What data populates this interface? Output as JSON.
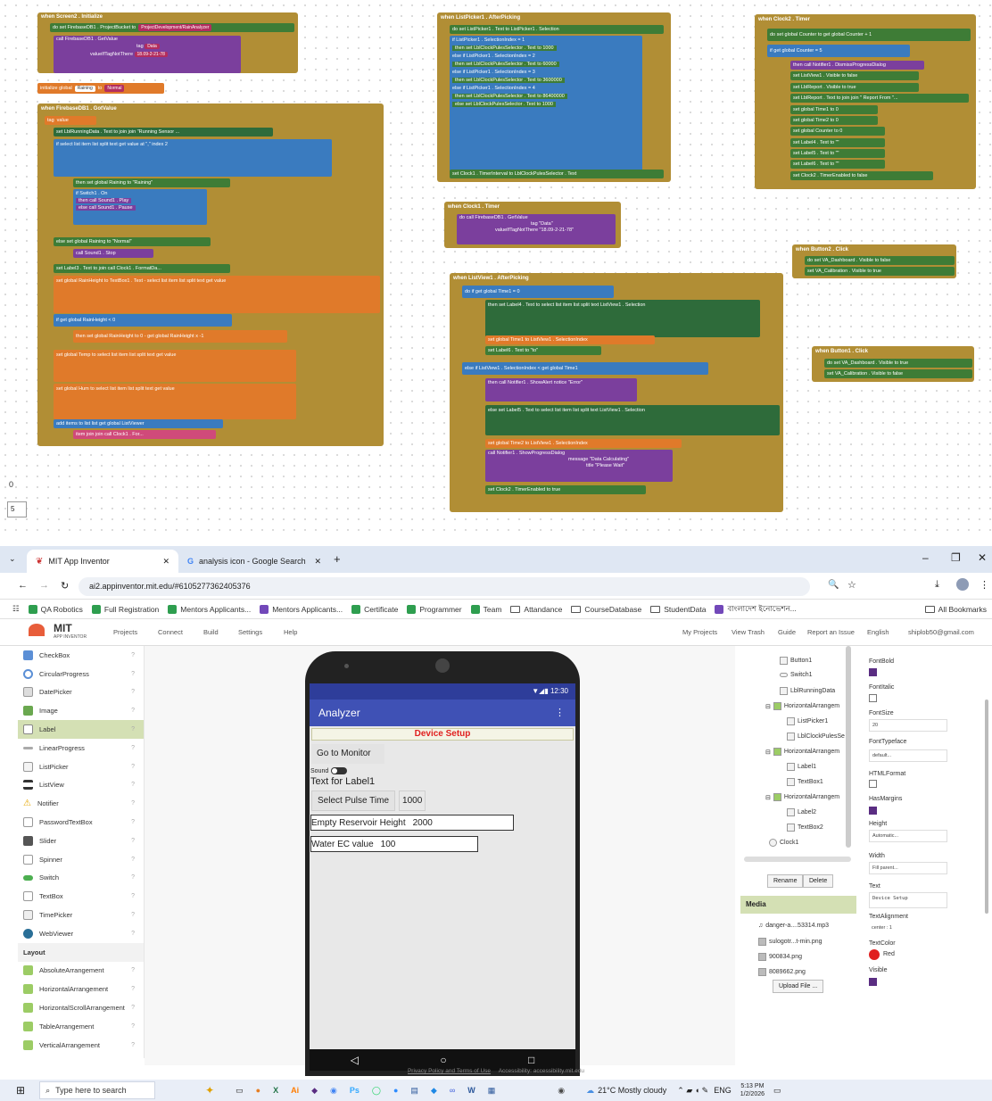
{
  "blocks": {
    "screen2_init": {
      "event": "when Screen2 . Initialize",
      "rows": [
        "do  set FirebaseDB1 . ProjectBucket to",
        "call FirebaseDB1 . GetValue",
        "tag",
        "valueIfTagNotThere"
      ],
      "bucket": "ProjectDevelopment/RainAnalyzer",
      "tag": "Data",
      "value": "18.09-2-21-78"
    },
    "init_global": {
      "label": "initialize global",
      "name": "Raining",
      "to": "to",
      "value": "Normal"
    },
    "firebase_got": {
      "event": "when FirebaseDB1 . GotValue",
      "params": [
        "tag",
        "value"
      ],
      "lines": [
        "set LblRunningData . Text to  join join \"Running Sensor ...",
        "if  select list item list  split text  get value  at  \",\"  index 2",
        "then  set global Raining to \"Raining\"",
        "if Switch1 . On",
        "then call Sound1 . Play",
        "else call Sound1 . Pause",
        "else set global Raining to \"Normal\"",
        "call Sound1 . Stop",
        "set Label3 . Text to  join call Clock1 . FormatDa...",
        "set global RainHeight to  TextBox1 . Text  -  select list item list  split text  get value",
        "index 1",
        "if  get global RainHeight  <  0",
        "then  set global RainHeight to  0  -  get global RainHeight  x  -1",
        "set global Temp to  select list item list  split text  get value",
        "index 3",
        "set global Hum to  select list item list  split text  get value",
        "index 4",
        "add items to list  list  get global ListViewer",
        "item  join join call Clock1 . For..."
      ]
    },
    "listpicker1": {
      "event": "when ListPicker1 . AfterPicking",
      "lines": [
        "do set ListPicker1 . Text to  ListPicker1 . Selection",
        "if  ListPicker1 . SelectionIndex  =  1",
        "then set LblClockPulesSelector . Text to 1000",
        "else if ListPicker1 . SelectionIndex = 2",
        "then set LblClockPulesSelector . Text to 60000",
        "else if ListPicker1 . SelectionIndex = 3",
        "then set LblClockPulesSelector . Text to 3600000",
        "else if ListPicker1 . SelectionIndex = 4",
        "then set LblClockPulesSelector . Text to 86400000",
        "else set LblClockPulesSelector . Text to 1000",
        "set Clock1 . TimerInterval to LblClockPulesSelector . Text"
      ]
    },
    "clock1": {
      "event": "when Clock1 . Timer",
      "lines": [
        "do call FirebaseDB1 . GetValue",
        "tag \"Data\"",
        "valueIfTagNotThere \"18.09-2-21-78\""
      ]
    },
    "listview1": {
      "event": "when ListView1 . AfterPicking",
      "lines": [
        "do if  get global Time1  =  0",
        "then set Label4 . Text to  select list item list  split text  ListView1 . Selection",
        "at \",\"  index 1",
        "set global Time1 to ListView1 . SelectionIndex",
        "set Label6 . Text to \"to\"",
        "else if  ListView1 . SelectionIndex  <  get global Time1",
        "then call Notifier1 . ShowAlert  notice \"Error\"",
        "else set Label5 . Text to  select list item list  split text  ListView1 . Selection",
        "at \",\"  index 1",
        "set global Time2 to ListView1 . SelectionIndex",
        "call Notifier1 . ShowProgressDialog",
        "message \"Data Calculating\"",
        "title \"Please Wait\"",
        "set Clock2 . TimerEnabled to true"
      ]
    },
    "clock2": {
      "event": "when Clock2 . Timer",
      "lines": [
        "do set global Counter to  get global Counter  +  1",
        "if  get global Counter  =  5",
        "then call Notifier1 . DismissProgressDialog",
        "set ListView1 . Visible to false",
        "set LblReport . Visible to true",
        "set LblReport . Text to  join join \" Report From \"...",
        "set global Time1 to 0",
        "set global Time2 to 0",
        "set global Counter to 0",
        "set Label4 . Text to \"\"",
        "set Label5 . Text to \"\"",
        "set Label6 . Text to \"\"",
        "set Clock2 . TimerEnabled to false"
      ]
    },
    "button2": {
      "event": "when Button2 . Click",
      "lines": [
        "do set VA_Dashboard . Visible to false",
        "set VA_Calibration . Visible to true"
      ]
    },
    "button1": {
      "event": "when Button1 . Click",
      "lines": [
        "do set VA_Dashboard . Visible to true",
        "set VA_Calibration . Visible to false"
      ]
    }
  },
  "left_number": "0",
  "zoom_value": "5",
  "browser": {
    "tabs": [
      {
        "title": "MIT App Inventor"
      },
      {
        "title": "analysis icon - Google Search"
      }
    ],
    "url": "ai2.appinventor.mit.edu/#6105277362405376",
    "bookmarks": [
      "QA Robotics",
      "Full Registration",
      "Mentors Applicants...",
      "Mentors Applicants...",
      "Certificate",
      "Programmer",
      "Team",
      "Attandance",
      "CourseDatabase",
      "StudentData",
      "বাংলাদেশ ইনোভেশন..."
    ],
    "all_bookmarks": "All Bookmarks"
  },
  "ai_header": {
    "logo": "MIT",
    "logo_sub": "APP INVENTOR",
    "menus": [
      "Projects",
      "Connect",
      "Build",
      "Settings",
      "Help"
    ],
    "right_links": [
      "My Projects",
      "View Trash",
      "Guide",
      "Report an Issue",
      "English",
      "shiplob50@gmail.com"
    ]
  },
  "palette": {
    "items": [
      "CheckBox",
      "CircularProgress",
      "DatePicker",
      "Image",
      "Label",
      "LinearProgress",
      "ListPicker",
      "ListView",
      "Notifier",
      "PasswordTextBox",
      "Slider",
      "Spinner",
      "Switch",
      "TextBox",
      "TimePicker",
      "WebViewer"
    ],
    "selected": "Label",
    "section": "Layout",
    "layout_items": [
      "AbsoluteArrangement",
      "HorizontalArrangement",
      "HorizontalScrollArrangement",
      "TableArrangement",
      "VerticalArrangement"
    ]
  },
  "phone": {
    "time": "12:30",
    "app_title": "Analyzer",
    "device_setup": "Device Setup",
    "go_monitor": "Go to Monitor",
    "sound": "Sound",
    "label1": "Text for Label1",
    "select_pulse": "Select Pulse Time",
    "pulse_value": "1000",
    "empty_height": "Empty Reservoir Height",
    "height_value": "2000",
    "water_ec": "Water EC value",
    "ec_value": "100"
  },
  "tree": {
    "items": [
      "Button1",
      "Switch1",
      "LblRunningData",
      "HorizontalArrangem",
      "ListPicker1",
      "LblClockPulesSe",
      "HorizontalArrangem",
      "Label1",
      "TextBox1",
      "HorizontalArrangem",
      "Label2",
      "TextBox2",
      "Clock1"
    ],
    "rename": "Rename",
    "delete": "Delete",
    "media_title": "Media",
    "media": [
      "danger-a....53314.mp3",
      "sulogotr...t-min.png",
      "900834.png",
      "8089662.png"
    ],
    "upload": "Upload File ..."
  },
  "props": {
    "font_bold": "FontBold",
    "font_italic": "FontItalic",
    "font_size": "FontSize",
    "font_size_value": "20",
    "font_typeface": "FontTypeface",
    "font_typeface_value": "default...",
    "html_format": "HTMLFormat",
    "has_margins": "HasMargins",
    "height": "Height",
    "height_value": "Automatic...",
    "width": "Width",
    "width_value": "Fill parent...",
    "text": "Text",
    "text_value": "Device Setup",
    "text_alignment": "TextAlignment",
    "text_alignment_value": "center : 1",
    "text_color": "TextColor",
    "text_color_value": "Red",
    "visible": "Visible"
  },
  "footer": {
    "privacy": "Privacy Policy and Terms of Use",
    "accessibility": "Accessibility: accessibility.mit.edu"
  },
  "taskbar": {
    "search": "Type here to search",
    "weather": "21°C  Mostly cloudy",
    "lang": "ENG",
    "time": "5:13 PM",
    "date": "1/2/2026"
  },
  "colors": {
    "accent": "#3f51b5",
    "device_setup_red": "#e02020",
    "block_gold": "#b18e35"
  }
}
